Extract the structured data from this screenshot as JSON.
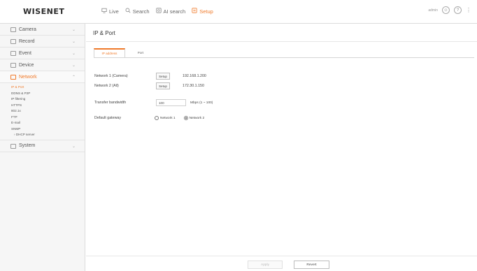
{
  "app": {
    "logo": "WISENET"
  },
  "topnav": {
    "items": [
      {
        "label": "Live",
        "icon": "monitor-icon"
      },
      {
        "label": "Search",
        "icon": "search-icon"
      },
      {
        "label": "AI search",
        "icon": "ai-search-icon"
      },
      {
        "label": "Setup",
        "icon": "setup-icon",
        "active": true
      }
    ],
    "user": "admin",
    "accent": "#f07a2a"
  },
  "sidebar": {
    "items": [
      {
        "label": "Camera"
      },
      {
        "label": "Record"
      },
      {
        "label": "Event"
      },
      {
        "label": "Device"
      },
      {
        "label": "Network",
        "active": true
      },
      {
        "label": "System"
      }
    ],
    "network_sub": [
      {
        "label": "IP & Port",
        "active": true
      },
      {
        "label": "DDNS & P2P"
      },
      {
        "label": "IP filtering"
      },
      {
        "label": "HTTPS"
      },
      {
        "label": "802.1x"
      },
      {
        "label": "FTP"
      },
      {
        "label": "E-mail"
      },
      {
        "label": "SNMP"
      },
      {
        "label": "DHCP server"
      }
    ]
  },
  "main": {
    "title": "IP & Port",
    "tabs": [
      "IP address",
      "Port"
    ],
    "network1": {
      "label": "Network 1 (Camera)",
      "button": "Setup",
      "ip": "192.168.1.200"
    },
    "network2": {
      "label": "Network 2 (All)",
      "button": "Setup",
      "ip": "172.30.1.150"
    },
    "bandwidth": {
      "label": "Transfer bandwidth",
      "value": "100",
      "unit": "Mbps (1 ~ 100)"
    },
    "gateway": {
      "label": "Default gateway",
      "option1": "Network 1",
      "option2": "Network 2",
      "selected": "Network 2"
    }
  },
  "footer": {
    "apply": "Apply",
    "revert": "Revert"
  }
}
